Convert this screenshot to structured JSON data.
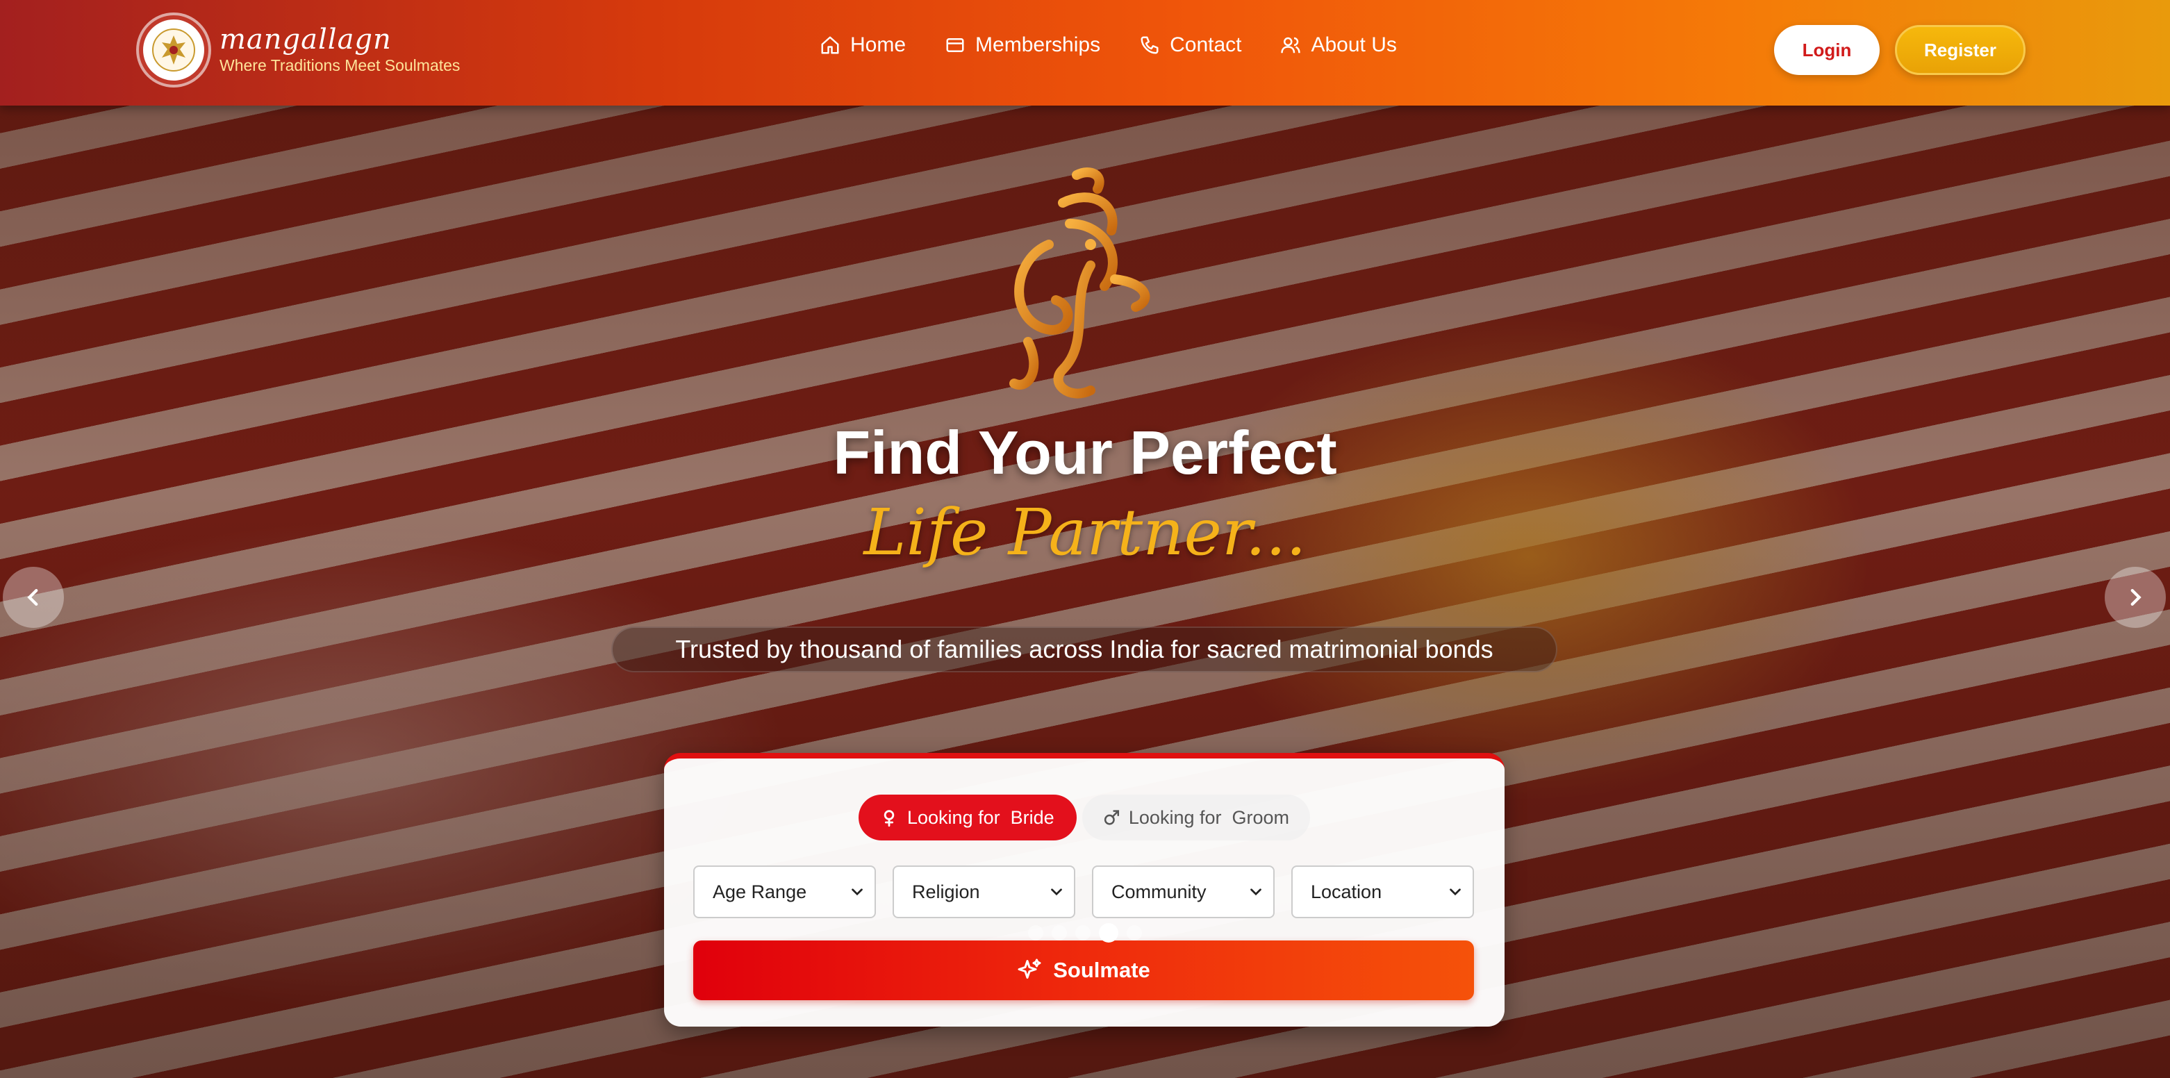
{
  "brand": {
    "name": "mangallagn",
    "tagline": "Where Traditions Meet Soulmates"
  },
  "nav": {
    "items": [
      {
        "label": "Home",
        "icon": "home-icon"
      },
      {
        "label": "Memberships",
        "icon": "card-icon"
      },
      {
        "label": "Contact",
        "icon": "phone-icon"
      },
      {
        "label": "About Us",
        "icon": "users-icon"
      }
    ],
    "login_label": "Login",
    "register_label": "Register"
  },
  "hero": {
    "title": "Find Your Perfect",
    "script_title": "Life Partner...",
    "subtitle": "Trusted by thousand of families across India for sacred matrimonial bonds"
  },
  "search": {
    "toggle_bride": "Looking for  Bride",
    "toggle_groom": "Looking for  Groom",
    "active_toggle": "bride",
    "filters": {
      "age": "Age Range",
      "religion": "Religion",
      "community": "Community",
      "location": "Location"
    },
    "submit_label": "Soulmate"
  },
  "carousel": {
    "slide_count": 5,
    "active_index": 4
  },
  "colors": {
    "primary_red": "#e3101c",
    "accent_gold": "#f5b21a",
    "header_start": "#a3201f",
    "header_end": "#e99a0c"
  }
}
